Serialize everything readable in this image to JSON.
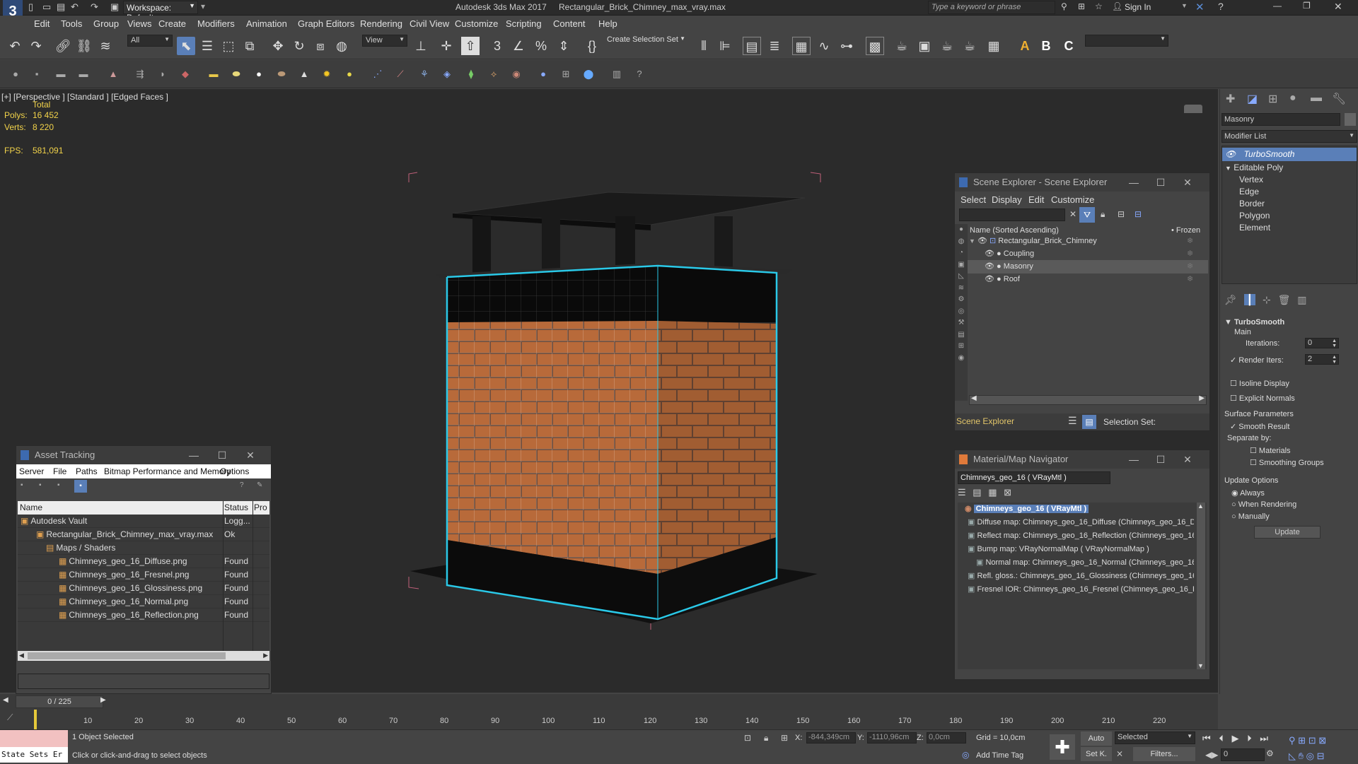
{
  "app": {
    "title": "Autodesk 3ds Max 2017",
    "file": "Rectangular_Brick_Chimney_max_vray.max",
    "workspace": "Workspace: Default",
    "search_placeholder": "Type a keyword or phrase",
    "sign_in": "Sign In"
  },
  "menu": [
    "Edit",
    "Tools",
    "Group",
    "Views",
    "Create",
    "Modifiers",
    "Animation",
    "Graph Editors",
    "Rendering",
    "Civil View",
    "Customize",
    "Scripting",
    "Content",
    "Help"
  ],
  "toolbar": {
    "filter": "All",
    "view": "View",
    "selection_set": "Create Selection Set"
  },
  "viewport": {
    "label": "[+] [Perspective ] [Standard ] [Edged Faces ]",
    "total_label": "Total",
    "polys_label": "Polys:",
    "polys": "16 452",
    "verts_label": "Verts:",
    "verts": "8 220",
    "fps_label": "FPS:",
    "fps": "581,091"
  },
  "scene_explorer": {
    "title": "Scene Explorer - Scene Explorer",
    "menu": [
      "Select",
      "Display",
      "Edit",
      "Customize"
    ],
    "col_name": "Name (Sorted Ascending)",
    "col_frozen": "• Frozen",
    "root": "Rectangular_Brick_Chimney",
    "children": [
      "Coupling",
      "Masonry",
      "Roof"
    ],
    "footer_name": "Scene Explorer",
    "selection_set_label": "Selection Set:"
  },
  "material_navigator": {
    "title": "Material/Map Navigator",
    "field": "Chimneys_geo_16  ( VRayMtl )",
    "root": "Chimneys_geo_16  ( VRayMtl )",
    "items": [
      "Diffuse map: Chimneys_geo_16_Diffuse (Chimneys_geo_16_Diff",
      "Reflect map: Chimneys_geo_16_Reflection (Chimneys_geo_16_I",
      "Bump map: VRayNormalMap  ( VRayNormalMap )",
      "Normal map: Chimneys_geo_16_Normal (Chimneys_geo_16_N",
      "Refl. gloss.: Chimneys_geo_16_Glossiness (Chimneys_geo_16_G",
      "Fresnel IOR: Chimneys_geo_16_Fresnel (Chimneys_geo_16_Fre"
    ]
  },
  "asset_tracking": {
    "title": "Asset Tracking",
    "menu": [
      "Server",
      "File",
      "Paths",
      "Bitmap Performance and Memory",
      "Options"
    ],
    "columns": [
      "Name",
      "Status",
      "Pro"
    ],
    "rows": [
      {
        "name": "Autodesk Vault",
        "status": "Logg..."
      },
      {
        "name": "Rectangular_Brick_Chimney_max_vray.max",
        "status": "Ok"
      },
      {
        "name": "Maps / Shaders",
        "status": ""
      },
      {
        "name": "Chimneys_geo_16_Diffuse.png",
        "status": "Found"
      },
      {
        "name": "Chimneys_geo_16_Fresnel.png",
        "status": "Found"
      },
      {
        "name": "Chimneys_geo_16_Glossiness.png",
        "status": "Found"
      },
      {
        "name": "Chimneys_geo_16_Normal.png",
        "status": "Found"
      },
      {
        "name": "Chimneys_geo_16_Reflection.png",
        "status": "Found"
      }
    ]
  },
  "command_panel": {
    "object_name": "Masonry",
    "modifier_list": "Modifier List",
    "stack": [
      "TurboSmooth",
      "Editable Poly",
      "Vertex",
      "Edge",
      "Border",
      "Polygon",
      "Element"
    ],
    "rollout": "TurboSmooth",
    "main": "Main",
    "iterations_label": "Iterations:",
    "iterations": "0",
    "render_iters_label": "Render Iters:",
    "render_iters": "2",
    "isoline": "Isoline Display",
    "explicit_normals": "Explicit Normals",
    "surface_params": "Surface Parameters",
    "smooth_result": "Smooth Result",
    "separate_by": "Separate by:",
    "materials": "Materials",
    "smoothing_groups": "Smoothing Groups",
    "update_options": "Update Options",
    "always": "Always",
    "when_rendering": "When Rendering",
    "manually": "Manually",
    "update_btn": "Update"
  },
  "timeline": {
    "frame": "0 / 225",
    "ticks": [
      "10",
      "20",
      "30",
      "40",
      "50",
      "60",
      "70",
      "80",
      "90",
      "100",
      "110",
      "120",
      "130",
      "140",
      "150",
      "160",
      "170",
      "180",
      "190",
      "200",
      "210",
      "220"
    ]
  },
  "status": {
    "state_sets": "State Sets Er",
    "selected": "1 Object Selected",
    "prompt": "Click or click-and-drag to select objects",
    "x_label": "X:",
    "x": "-844,349cm",
    "y_label": "Y:",
    "y": "-1110,96cm",
    "z_label": "Z:",
    "z": "0,0cm",
    "grid": "Grid = 10,0cm",
    "add_time_tag": "Add Time Tag",
    "auto": "Auto",
    "set_k": "Set K.",
    "selected_dd": "Selected",
    "filters": "Filters...",
    "frame_field": "0"
  },
  "colors": {
    "accent": "#5a7fb8",
    "stats": "#f2d34a",
    "selection": "#2ac9e8"
  }
}
